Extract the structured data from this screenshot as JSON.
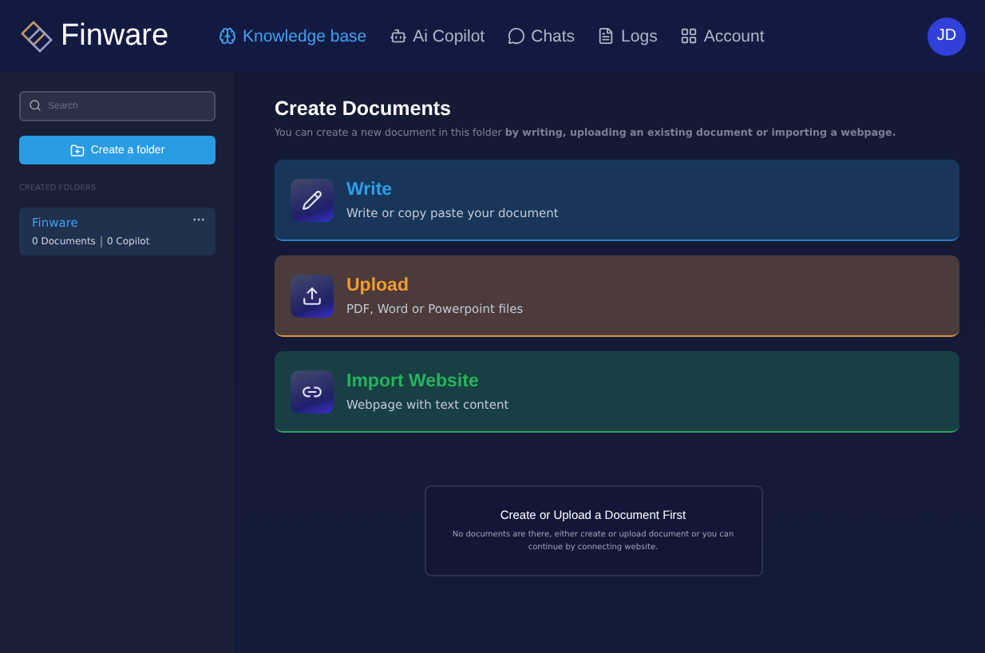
{
  "brand": "Finware",
  "nav": [
    {
      "label": "Knowledge base",
      "kind": "brain",
      "selected": true
    },
    {
      "label": "Ai Copilot",
      "kind": "bot",
      "selected": false
    },
    {
      "label": "Chats",
      "kind": "chat",
      "selected": false
    },
    {
      "label": "Logs",
      "kind": "logs",
      "selected": false
    },
    {
      "label": "Account",
      "kind": "grid",
      "selected": false
    }
  ],
  "avatar": "JD",
  "sidebar": {
    "search": {
      "placeholder": "Search"
    },
    "create_button": "Create a folder",
    "section_label": "CREATED FOLDERS",
    "folders": [
      {
        "name": "Finware",
        "documents": "0 Documents",
        "copilot": "0 Copilot",
        "selected": true
      }
    ]
  },
  "main": {
    "title": "Create Documents",
    "subtitle": "You can create a new document in this folder **by writing, uploading an existing document or importing a webpage.**",
    "options": [
      {
        "kind": "write",
        "title": "Write",
        "description": "Write or copy paste your document"
      },
      {
        "kind": "upload",
        "title": "Upload",
        "description": "PDF, Word or Powerpoint files"
      },
      {
        "kind": "import",
        "title": "Import Website",
        "description": "Webpage with text content"
      }
    ],
    "empty": {
      "title": "Create or Upload a Document First",
      "text": "No documents are there, either create or upload document or you can continue by connecting website."
    }
  }
}
